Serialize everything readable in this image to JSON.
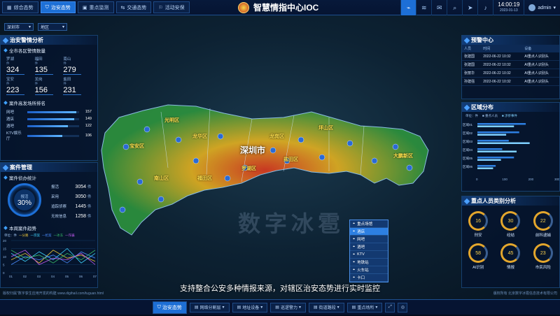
{
  "header": {
    "title": "智慧情指中心IOC",
    "tabs": [
      {
        "label": "综合态势",
        "icon": "grid-icon"
      },
      {
        "label": "治安态势",
        "icon": "shield-icon",
        "active": true
      },
      {
        "label": "重点监测",
        "icon": "monitor-icon"
      },
      {
        "label": "交通态势",
        "icon": "traffic-icon"
      },
      {
        "label": "活动安保",
        "icon": "event-icon"
      }
    ],
    "time": "14:00:19",
    "date": "2023-01-13",
    "user": "admin"
  },
  "filters": {
    "city": "深圳市",
    "district": "地区"
  },
  "left": {
    "title": "治安警情分析",
    "alarm_title": "全市各区警情数量",
    "unit": "件",
    "alarms": [
      {
        "name": "罗湖",
        "value": "324"
      },
      {
        "name": "福田",
        "value": "135"
      },
      {
        "name": "南山",
        "value": "279"
      },
      {
        "name": "宝安",
        "value": "223"
      },
      {
        "name": "龙岗",
        "value": "156"
      },
      {
        "name": "盐田",
        "value": "231"
      }
    ],
    "places_title": "案件高发场所排名",
    "places": [
      {
        "name": "网吧",
        "value": "157",
        "pct": 0.95
      },
      {
        "name": "酒店",
        "value": "149",
        "pct": 0.9
      },
      {
        "name": "酒吧",
        "value": "122",
        "pct": 0.78
      },
      {
        "name": "KTV娱乐厅",
        "value": "106",
        "pct": 0.68
      }
    ],
    "case_title": "案件管理",
    "case_stat_title": "案件侦办统计",
    "ring_label": "报活",
    "ring_value": "30%",
    "case_stats": [
      {
        "k": "报活",
        "v": "3054"
      },
      {
        "k": "采用",
        "v": "3050"
      },
      {
        "k": "追踪侦察",
        "v": "1445"
      },
      {
        "k": "无效信息",
        "v": "1258"
      }
    ],
    "case_unit": "件",
    "trend_title": "本周案件趋势",
    "trend_unit": "单位：件",
    "trend_legend": [
      "一分路",
      "一宗案",
      "一抢案",
      "一冰冻",
      "一诈骗"
    ],
    "chart_data": {
      "type": "line",
      "x": [
        "01",
        "02",
        "03",
        "04",
        "05",
        "06",
        "07"
      ],
      "ylim": [
        0,
        20
      ],
      "yticks": [
        "20",
        "15",
        "10",
        "5",
        "0"
      ],
      "series": [
        {
          "name": "一分路",
          "color": "#e8c23a",
          "values": [
            8,
            12,
            6,
            14,
            9,
            11,
            7
          ]
        },
        {
          "name": "一宗案",
          "color": "#3fd3ff",
          "values": [
            12,
            7,
            13,
            8,
            15,
            6,
            12
          ]
        },
        {
          "name": "一抢案",
          "color": "#4b8cff",
          "values": [
            5,
            10,
            8,
            11,
            6,
            13,
            9
          ]
        },
        {
          "name": "一冰冻",
          "color": "#39c26b",
          "values": [
            14,
            9,
            11,
            6,
            12,
            8,
            14
          ]
        },
        {
          "name": "一诈骗",
          "color": "#c45af0",
          "values": [
            10,
            14,
            5,
            9,
            8,
            12,
            5
          ]
        }
      ]
    }
  },
  "right": {
    "warn_title": "预警中心",
    "warn_cols": [
      "人员",
      "时间",
      "设备"
    ],
    "warn_rows": [
      [
        "张建国",
        "2022-06-22 10:32",
        "AI重点人识别头"
      ],
      [
        "张建国",
        "2022-06-22 10:32",
        "AI重点人识别头"
      ],
      [
        "张丽华",
        "2022-06-22 10:32",
        "AI重点人识别头"
      ],
      [
        "孙建强",
        "2022-06-22 10:32",
        "AI重点人识别头"
      ]
    ],
    "dist_title": "区域分布",
    "dist_unit": "单位：件",
    "dist_legend": [
      "重点人员",
      "涉侨事件"
    ],
    "dist_rows": [
      {
        "name": "区域01",
        "a": 185,
        "b": 140
      },
      {
        "name": "区域02",
        "a": 160,
        "b": 110
      },
      {
        "name": "区域03",
        "a": 120,
        "b": 200
      },
      {
        "name": "区域04",
        "a": 95,
        "b": 150
      },
      {
        "name": "区域05",
        "a": 140,
        "b": 90
      },
      {
        "name": "区域06",
        "a": 70,
        "b": 60
      }
    ],
    "dist_axis": [
      "0",
      "100",
      "200",
      "300"
    ],
    "people_title": "重点人员类别分析",
    "people": [
      {
        "name": "刑安",
        "value": "16"
      },
      {
        "name": "经结",
        "value": "30"
      },
      {
        "name": "前科逮捕",
        "value": "22"
      },
      {
        "name": "AI识别",
        "value": "58"
      },
      {
        "name": "情报",
        "value": "45"
      },
      {
        "name": "市民风险",
        "value": "23"
      }
    ]
  },
  "map": {
    "city_label": "深圳市",
    "districts": [
      "光明区",
      "龙华区",
      "宝安区",
      "龙岗区",
      "坪山区",
      "南山区",
      "福田区",
      "罗湖区",
      "盐田区",
      "大鹏新区"
    ],
    "menu": [
      {
        "label": "重点场馆"
      },
      {
        "label": "酒店",
        "on": true
      },
      {
        "label": "网吧"
      },
      {
        "label": "酒吧"
      },
      {
        "label": "KTV"
      },
      {
        "label": "地铁站"
      },
      {
        "label": "火车站"
      },
      {
        "label": "卡口"
      }
    ],
    "watermark": "数字冰雹"
  },
  "caption": "支持整合公安多种情报来源，对辖区治安态势进行实时监控",
  "footer": {
    "left": "版权归属\"数字孪生应用开发的构建 www.digihail.com/tuguan.html",
    "right": "版权所有 北京数字冰雹信息技术有限公司"
  },
  "bottom": {
    "items": [
      {
        "label": "治安态势",
        "active": true
      },
      {
        "label": "网络分割层"
      },
      {
        "label": "地址设备"
      },
      {
        "label": "巡逻警力"
      },
      {
        "label": "街道路段"
      },
      {
        "label": "重点场所"
      }
    ]
  }
}
